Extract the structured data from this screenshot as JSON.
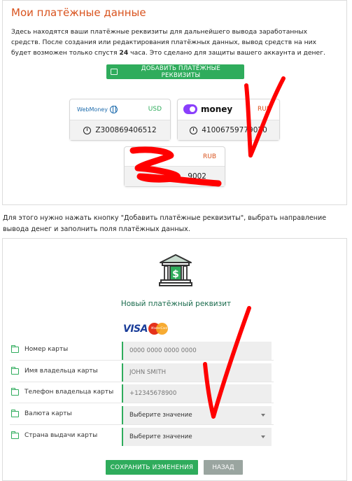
{
  "top": {
    "title": "Мои платёжные данные",
    "description_1": "Здесь находятся ваши платёжные реквизиты для дальнейшего вывода заработанных средств. После создания или редактирования платёжных данных, вывод средств на них будет возможен только спустя ",
    "description_bold": "24",
    "description_2": " часа. Это сделано для защиты вашего аккаунта и денег.",
    "add_button": "ДОБАВИТЬ ПЛАТЁЖНЫЕ РЕКВИЗИТЫ"
  },
  "cards": [
    {
      "logo": "WebMoney",
      "currency": "USD",
      "currency_color": "#2fac5c",
      "number": "Z300869406512"
    },
    {
      "logo": "money",
      "currency": "RUB",
      "currency_color": "#d9531e",
      "number": "41006759779020"
    },
    {
      "logo": "",
      "currency": "RUB",
      "currency_color": "#d9531e",
      "number": "9002"
    }
  ],
  "between_text": "Для этого нужно нажать кнопку \"Добавить платёжные реквизиты\", выбрать направление вывода денег и заполнить поля платёжных данных.",
  "form": {
    "subtitle": "Новый платёжный реквизит",
    "visa": "VISA",
    "mastercard": "MasterCard",
    "rows": [
      {
        "label": "Номер карты",
        "placeholder": "0000 0000 0000 0000"
      },
      {
        "label": "Имя владельца карты",
        "placeholder": "JOHN SMITH"
      },
      {
        "label": "Телефон владельца карты",
        "placeholder": "+12345678900"
      },
      {
        "label": "Валюта карты",
        "value": "Выберите значение"
      },
      {
        "label": "Страна выдачи карты",
        "value": "Выберите значение"
      }
    ],
    "save_button": "СОХРАНИТЬ ИЗМЕНЕНИЯ",
    "back_button": "НАЗАД"
  },
  "colors": {
    "accent": "#2fac5c",
    "title": "#d9531e",
    "annotation": "#ff0000"
  }
}
